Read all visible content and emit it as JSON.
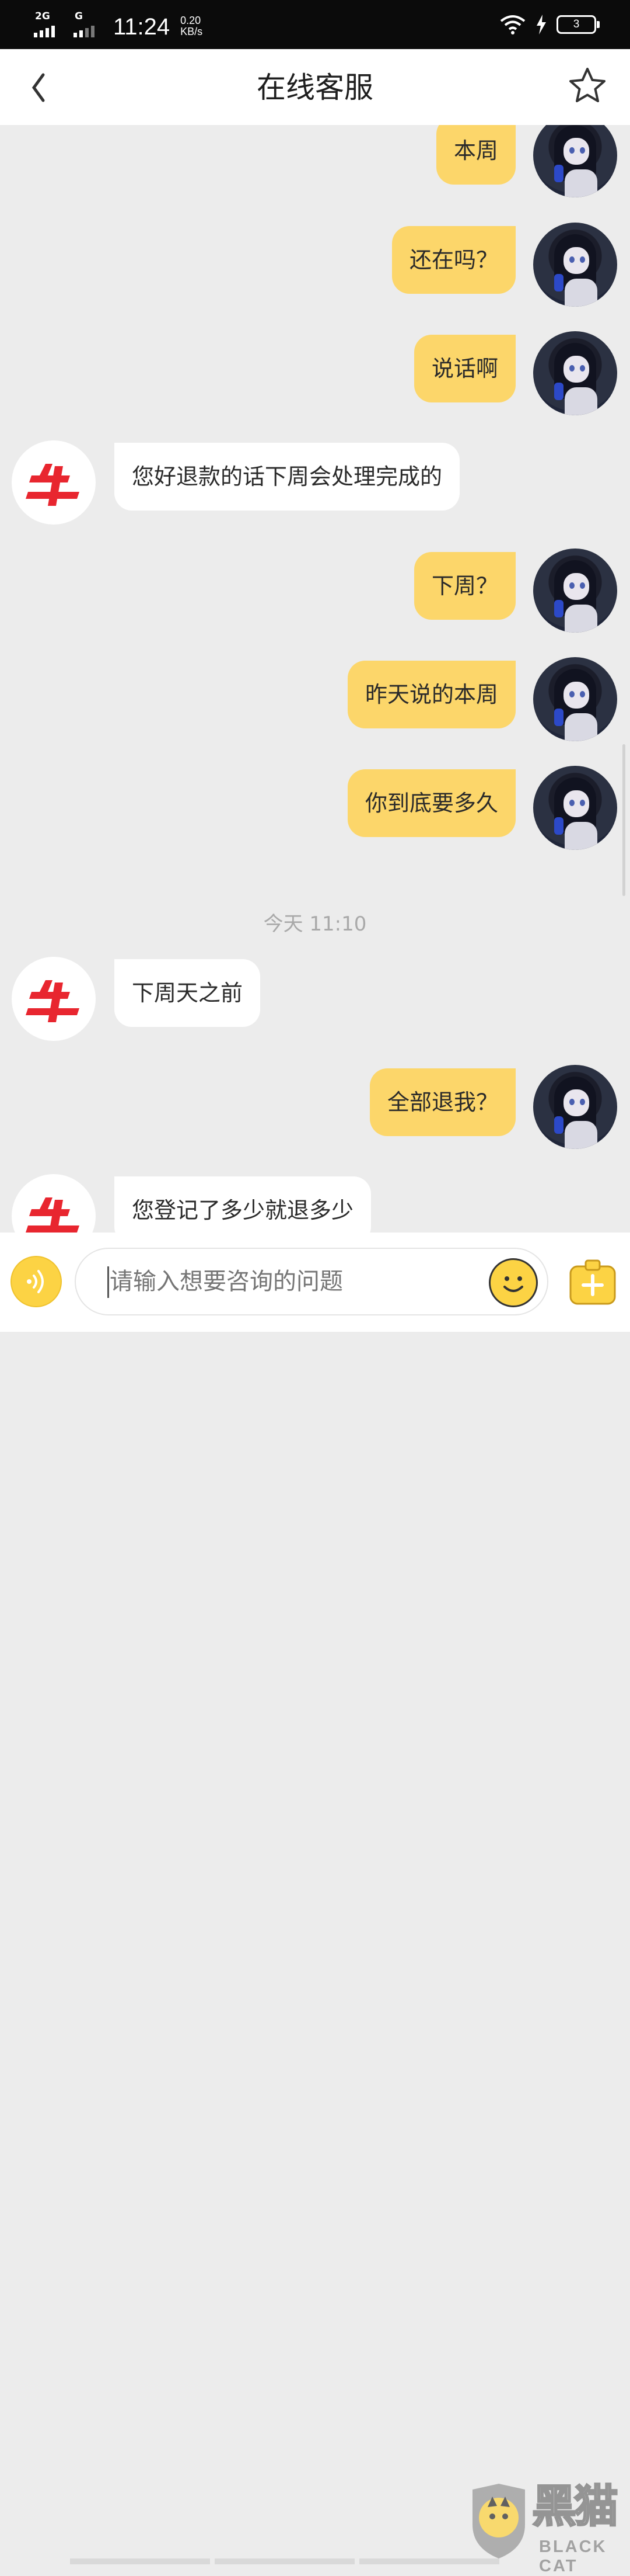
{
  "status_bar": {
    "network_1": "2G",
    "network_2": "G",
    "time": "11:24",
    "speed_value": "0.20",
    "speed_unit": "KB/s",
    "battery": "3"
  },
  "header": {
    "title": "在线客服",
    "icons": [
      "chevron-left-icon",
      "star-icon"
    ]
  },
  "messages": [
    {
      "sender": "user",
      "text": "本周"
    },
    {
      "sender": "user",
      "text": "还在吗？"
    },
    {
      "sender": "user",
      "text": "说话啊"
    },
    {
      "sender": "agent",
      "text": "您好退款的话下周会处理完成的"
    },
    {
      "sender": "user",
      "text": "下周？"
    },
    {
      "sender": "user",
      "text": "昨天说的本周"
    },
    {
      "sender": "user",
      "text": "你到底要多久"
    },
    {
      "sender": "agent",
      "text": "下周天之前"
    },
    {
      "sender": "user",
      "text": "全部退我？"
    },
    {
      "sender": "agent",
      "text": "您登记了多少就退多少"
    }
  ],
  "timestamp": "今天 11:10",
  "input": {
    "placeholder": "请输入想要咨询的问题",
    "icons": [
      "voice-icon",
      "emoji-icon",
      "plus-icon"
    ]
  },
  "watermark": {
    "cn": "黑猫",
    "en": "BLACK CAT"
  },
  "colors": {
    "user_bubble": "#fcd66a",
    "agent_bubble": "#ffffff",
    "background": "#ececec",
    "brand_red": "#e8262f"
  }
}
